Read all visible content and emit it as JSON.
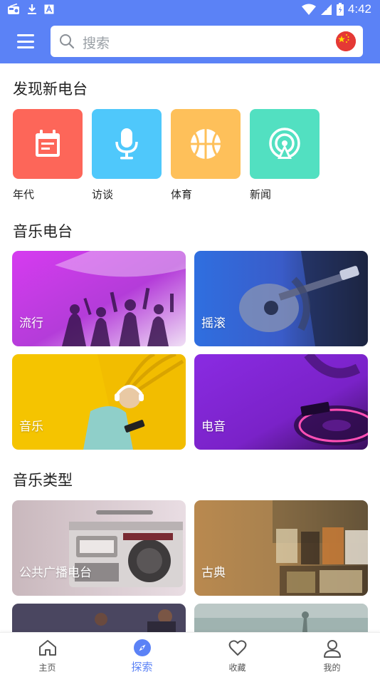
{
  "status_bar": {
    "time": "4:42"
  },
  "header": {
    "search_placeholder": "搜索"
  },
  "discover": {
    "title": "发现新电台",
    "items": [
      {
        "label": "年代",
        "icon": "calendar-icon",
        "color": "#fd6659"
      },
      {
        "label": "访谈",
        "icon": "microphone-icon",
        "color": "#4fc8fb"
      },
      {
        "label": "体育",
        "icon": "basketball-icon",
        "color": "#fec05a"
      },
      {
        "label": "新闻",
        "icon": "broadcast-icon",
        "color": "#52e0c1"
      }
    ]
  },
  "music_radio": {
    "title": "音乐电台",
    "cards": [
      {
        "label": "流行"
      },
      {
        "label": "摇滚"
      },
      {
        "label": "音乐"
      },
      {
        "label": "电音"
      }
    ]
  },
  "music_types": {
    "title": "音乐类型",
    "cards": [
      {
        "label": "公共广播电台"
      },
      {
        "label": "古典"
      }
    ]
  },
  "bottom_nav": {
    "items": [
      {
        "label": "主页",
        "icon": "home-icon"
      },
      {
        "label": "探索",
        "icon": "compass-icon",
        "active": true
      },
      {
        "label": "收藏",
        "icon": "heart-icon"
      },
      {
        "label": "我的",
        "icon": "user-icon"
      }
    ]
  },
  "colors": {
    "accent": "#5b82f6"
  }
}
